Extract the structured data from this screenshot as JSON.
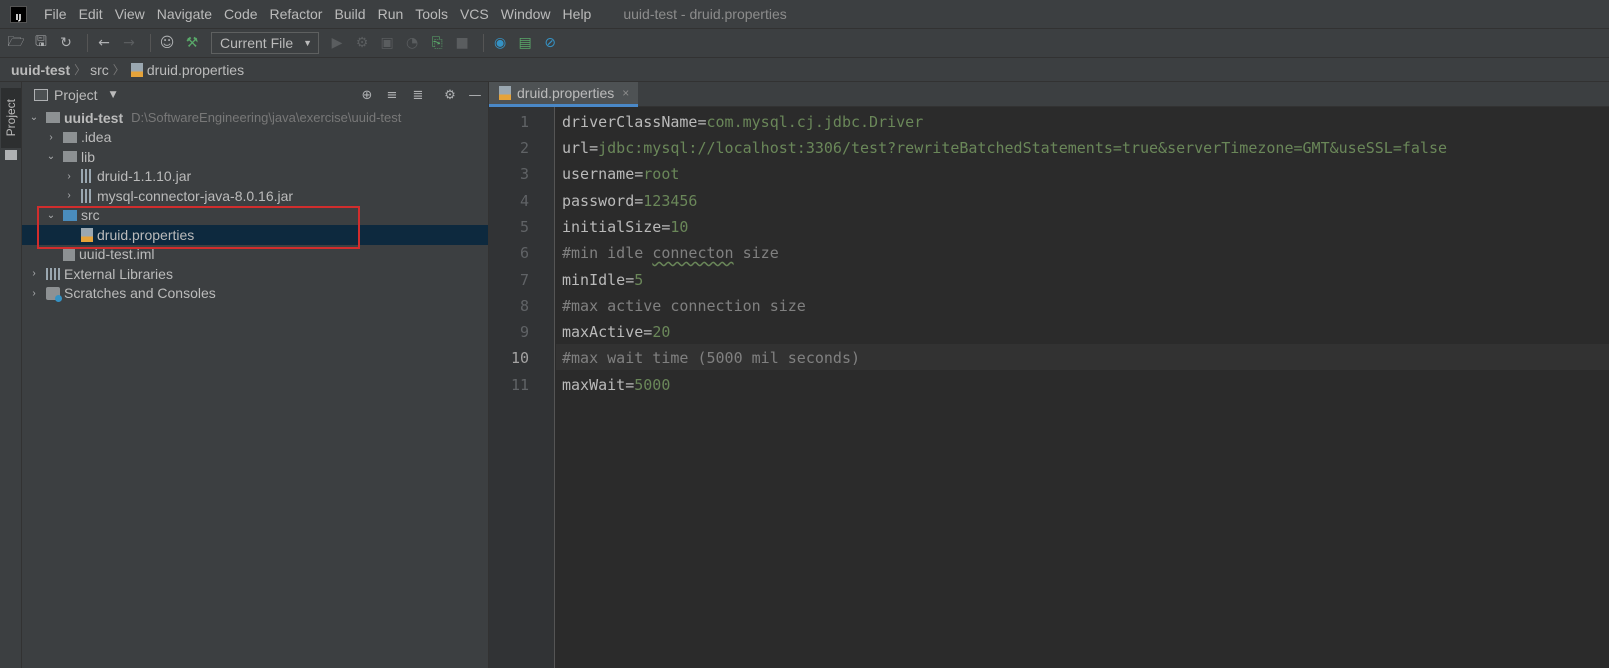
{
  "app": {
    "logo_text": "IJ",
    "window_title": "uuid-test - druid.properties"
  },
  "menu": [
    "File",
    "Edit",
    "View",
    "Navigate",
    "Code",
    "Refactor",
    "Build",
    "Run",
    "Tools",
    "VCS",
    "Window",
    "Help"
  ],
  "toolbar": {
    "run_config": "Current File",
    "icons": [
      "open-folder-icon",
      "save-icon",
      "sync-icon",
      "back-icon",
      "forward-icon",
      "user-icon",
      "build-hammer-icon",
      "run-icon",
      "debug-icon",
      "coverage-icon",
      "profile-icon",
      "attach-icon",
      "stop-icon",
      "code-with-me-icon",
      "monitor-icon",
      "power-save-icon"
    ]
  },
  "breadcrumb": [
    "uuid-test",
    "src",
    "druid.properties"
  ],
  "left_strip": {
    "project_label": "Project"
  },
  "project_panel": {
    "title": "Project",
    "tree": [
      {
        "name": "uuid-test",
        "path": "D:\\SoftwareEngineering\\java\\exercise\\uuid-test"
      },
      {
        "name": ".idea"
      },
      {
        "name": "lib"
      },
      {
        "name": "druid-1.1.10.jar"
      },
      {
        "name": "mysql-connector-java-8.0.16.jar"
      },
      {
        "name": "src"
      },
      {
        "name": "druid.properties"
      },
      {
        "name": "uuid-test.iml"
      },
      {
        "name": "External Libraries"
      },
      {
        "name": "Scratches and Consoles"
      }
    ]
  },
  "editor": {
    "tab_label": "druid.properties",
    "tab_close": "×",
    "current_line": 10,
    "lines": [
      {
        "num": "1",
        "key": "driverClassName",
        "value": "com.mysql.cj.jdbc.Driver"
      },
      {
        "num": "2",
        "key": "url",
        "value": "jdbc:mysql://localhost:3306/test?rewriteBatchedStatements=true&serverTimezone=GMT&useSSL=false"
      },
      {
        "num": "3",
        "key": "username",
        "value": "root"
      },
      {
        "num": "4",
        "key": "password",
        "value": "123456"
      },
      {
        "num": "5",
        "key": "initialSize",
        "value": "10"
      },
      {
        "num": "6",
        "comment_pre": "#min idle ",
        "comment_typo": "connecton",
        "comment_post": " size"
      },
      {
        "num": "7",
        "key": "minIdle",
        "value": "5"
      },
      {
        "num": "8",
        "comment": "#max active connection size"
      },
      {
        "num": "9",
        "key": "maxActive",
        "value": "20"
      },
      {
        "num": "10",
        "comment": "#max wait time (5000 mil seconds)"
      },
      {
        "num": "11",
        "key": "maxWait",
        "value": "5000"
      }
    ]
  },
  "colors": {
    "background": "#2b2b2b",
    "panel": "#3c3f41",
    "selection": "#0d293e",
    "highlight_box": "#d12d2d",
    "property_value": "#6a8759",
    "comment": "#808080",
    "accent": "#4a88c7"
  }
}
